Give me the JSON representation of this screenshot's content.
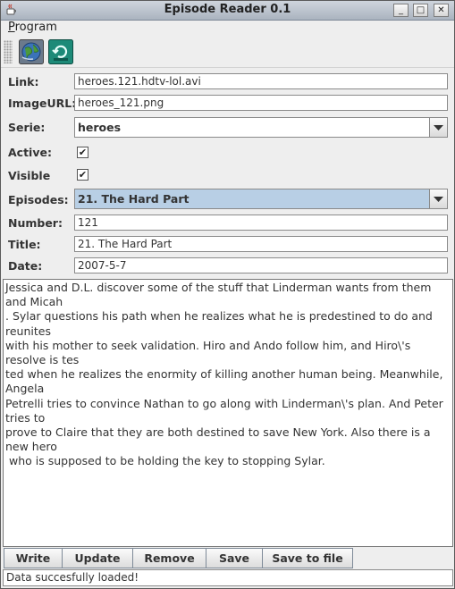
{
  "window": {
    "title": "Episode Reader 0.1",
    "controls": {
      "minimize": "_",
      "maximize": "□",
      "close": "✕"
    }
  },
  "menu": {
    "program": "Program"
  },
  "toolbar": {
    "globe_icon": "globe-icon",
    "refresh_icon": "refresh-icon"
  },
  "form": {
    "link": {
      "label": "Link:",
      "value": "heroes.121.hdtv-lol.avi"
    },
    "image_url": {
      "label": "ImageURL:",
      "value": "heroes_121.png"
    },
    "serie": {
      "label": "Serie:",
      "value": "heroes"
    },
    "active": {
      "label": "Active:",
      "checked": true,
      "mark": "✔"
    },
    "visible": {
      "label": "Visible",
      "checked": true,
      "mark": "✔"
    },
    "episodes": {
      "label": "Episodes:",
      "value": "21. The Hard Part"
    },
    "number": {
      "label": "Number:",
      "value": "121"
    },
    "title": {
      "label": "Title:",
      "value": "21. The Hard Part"
    },
    "date": {
      "label": "Date:",
      "value": "2007-5-7"
    }
  },
  "description": "Jessica and D.L. discover some of the stuff that Linderman wants from them and Micah\n. Sylar questions his path when he realizes what he is predestined to do and reunites\nwith his mother to seek validation. Hiro and Ando follow him, and Hiro\\'s resolve is tes\nted when he realizes the enormity of killing another human being. Meanwhile, Angela\nPetrelli tries to convince Nathan to go along with Linderman\\'s plan. And Peter tries to\nprove to Claire that they are both destined to save New York. Also there is a new hero\n who is supposed to be holding the key to stopping Sylar.",
  "buttons": {
    "write": "Write",
    "update": "Update",
    "remove": "Remove",
    "save": "Save",
    "save_to_file": "Save to file"
  },
  "status": "Data succesfully loaded!"
}
